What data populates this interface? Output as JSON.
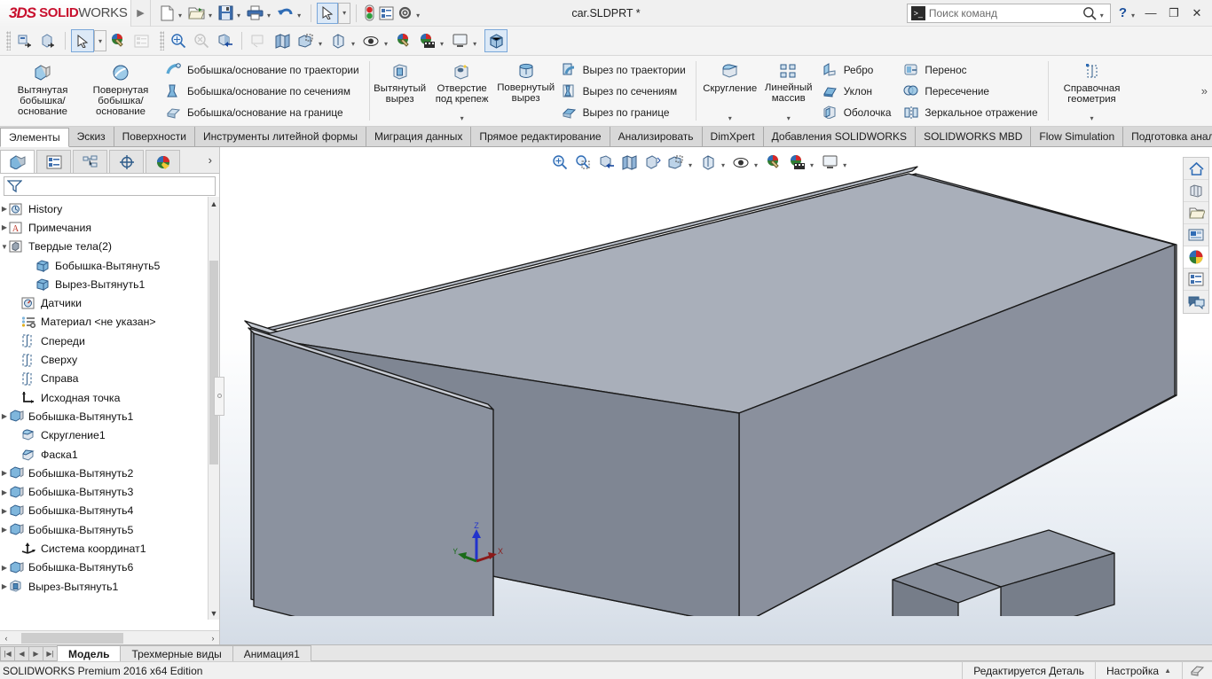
{
  "titlebar": {
    "brand_3ds": "3DS",
    "brand_solid": "SOLID",
    "brand_works": "WORKS",
    "document_title": "car.SLDPRT *",
    "search_placeholder": "Поиск команд",
    "icons": [
      "new-document-icon",
      "open-document-icon",
      "save-icon",
      "print-icon",
      "undo-icon",
      "select-icon",
      "rebuild-icon",
      "options-list-icon",
      "gear-icon"
    ],
    "help_label": "?",
    "minimize_label": "—",
    "restore_label": "❐",
    "close_label": "✕"
  },
  "command_strip": {
    "icons": [
      "import-icon",
      "export-icon",
      "select-arrow-icon",
      "appearance-icon",
      "display-pane-icon",
      "zoom-in-icon",
      "zoom-to-fit-icon",
      "section-view-icon",
      "draft-analysis-icon",
      "view-orientation-icon",
      "display-style-icon",
      "hide-show-icon",
      "appearances-icon",
      "scene-icon",
      "viewport-icon",
      "apply-scene-icon"
    ]
  },
  "ribbon": {
    "groups": [
      {
        "name": "boss-group",
        "big": [
          {
            "label": "Вытянутая\nбобышка/основание",
            "icon": "extruded-boss-icon",
            "dropdown": false
          },
          {
            "label": "Повернутая\nбобышка/основание",
            "icon": "revolved-boss-icon",
            "dropdown": false
          }
        ],
        "small": [
          {
            "label": "Бобышка/основание по траектории",
            "icon": "swept-boss-icon"
          },
          {
            "label": "Бобышка/основание по сечениям",
            "icon": "lofted-boss-icon"
          },
          {
            "label": "Бобышка/основание на границе",
            "icon": "boundary-boss-icon"
          }
        ]
      },
      {
        "name": "cut-group",
        "big": [
          {
            "label": "Вытянутый\nвырез",
            "icon": "extruded-cut-icon",
            "dropdown": false
          },
          {
            "label": "Отверстие\nпод крепеж",
            "icon": "hole-wizard-icon",
            "dropdown": true
          },
          {
            "label": "Повернутый\nвырез",
            "icon": "revolved-cut-icon",
            "dropdown": false
          }
        ],
        "small": [
          {
            "label": "Вырез по траектории",
            "icon": "swept-cut-icon"
          },
          {
            "label": "Вырез по сечениям",
            "icon": "lofted-cut-icon"
          },
          {
            "label": "Вырез по границе",
            "icon": "boundary-cut-icon"
          }
        ]
      },
      {
        "name": "feature-group",
        "big": [
          {
            "label": "Скругление",
            "icon": "fillet-icon",
            "dropdown": true
          },
          {
            "label": "Линейный\nмассив",
            "icon": "linear-pattern-icon",
            "dropdown": true
          }
        ],
        "small": [
          {
            "label": "Ребро",
            "icon": "rib-icon"
          },
          {
            "label": "Уклон",
            "icon": "draft-icon"
          },
          {
            "label": "Оболочка",
            "icon": "shell-icon"
          }
        ],
        "small2": [
          {
            "label": "Перенос",
            "icon": "move-icon"
          },
          {
            "label": "Пересечение",
            "icon": "intersect-icon"
          },
          {
            "label": "Зеркальное отражение",
            "icon": "mirror-icon"
          }
        ]
      },
      {
        "name": "reference-group",
        "big": [
          {
            "label": "Справочная\nгеометрия",
            "icon": "reference-geometry-icon",
            "dropdown": true
          }
        ]
      }
    ],
    "overflow_label": "»"
  },
  "tabs": [
    {
      "label": "Элементы",
      "active": true
    },
    {
      "label": "Эскиз",
      "active": false
    },
    {
      "label": "Поверхности",
      "active": false
    },
    {
      "label": "Инструменты литейной формы",
      "active": false
    },
    {
      "label": "Миграция данных",
      "active": false
    },
    {
      "label": "Прямое редактирование",
      "active": false
    },
    {
      "label": "Анализировать",
      "active": false
    },
    {
      "label": "DimXpert",
      "active": false
    },
    {
      "label": "Добавления SOLIDWORKS",
      "active": false
    },
    {
      "label": "SOLIDWORKS MBD",
      "active": false
    },
    {
      "label": "Flow Simulation",
      "active": false
    },
    {
      "label": "Подготовка анализа",
      "active": false
    }
  ],
  "feature_manager": {
    "tabs": [
      {
        "name": "feature-tree-tab",
        "icon": "feature-tree-icon",
        "active": true
      },
      {
        "name": "property-manager-tab",
        "icon": "property-manager-icon",
        "active": false
      },
      {
        "name": "configuration-manager-tab",
        "icon": "configuration-icon",
        "active": false
      },
      {
        "name": "dimxpert-manager-tab",
        "icon": "dimxpert-icon",
        "active": false
      },
      {
        "name": "display-manager-tab",
        "icon": "display-manager-icon",
        "active": false
      }
    ],
    "more_label": "›",
    "filter_placeholder": "",
    "tree": [
      {
        "label": "History",
        "icon": "history-icon",
        "indent": 0,
        "twisty": "collapsed"
      },
      {
        "label": "Примечания",
        "icon": "annotations-icon",
        "indent": 0,
        "twisty": "collapsed"
      },
      {
        "label": "Твердые тела(2)",
        "icon": "solid-bodies-icon",
        "indent": 0,
        "twisty": "expanded"
      },
      {
        "label": "Бобышка-Вытянуть5",
        "icon": "body-icon",
        "indent": 2,
        "twisty": "none"
      },
      {
        "label": "Вырез-Вытянуть1",
        "icon": "body-icon",
        "indent": 2,
        "twisty": "none"
      },
      {
        "label": "Датчики",
        "icon": "sensors-icon",
        "indent": 1,
        "twisty": "none"
      },
      {
        "label": "Материал <не указан>",
        "icon": "material-icon",
        "indent": 1,
        "twisty": "none"
      },
      {
        "label": "Спереди",
        "icon": "plane-icon",
        "indent": 1,
        "twisty": "none"
      },
      {
        "label": "Сверху",
        "icon": "plane-icon",
        "indent": 1,
        "twisty": "none"
      },
      {
        "label": "Справа",
        "icon": "plane-icon",
        "indent": 1,
        "twisty": "none"
      },
      {
        "label": "Исходная точка",
        "icon": "origin-icon",
        "indent": 1,
        "twisty": "none"
      },
      {
        "label": "Бобышка-Вытянуть1",
        "icon": "extrude-feature-icon",
        "indent": 0,
        "twisty": "collapsed"
      },
      {
        "label": "Скругление1",
        "icon": "fillet-feature-icon",
        "indent": 1,
        "twisty": "none"
      },
      {
        "label": "Фаска1",
        "icon": "chamfer-feature-icon",
        "indent": 1,
        "twisty": "none"
      },
      {
        "label": "Бобышка-Вытянуть2",
        "icon": "extrude-feature-icon",
        "indent": 0,
        "twisty": "collapsed"
      },
      {
        "label": "Бобышка-Вытянуть3",
        "icon": "extrude-feature-icon",
        "indent": 0,
        "twisty": "collapsed"
      },
      {
        "label": "Бобышка-Вытянуть4",
        "icon": "extrude-feature-icon",
        "indent": 0,
        "twisty": "collapsed"
      },
      {
        "label": "Бобышка-Вытянуть5",
        "icon": "extrude-feature-icon",
        "indent": 0,
        "twisty": "collapsed"
      },
      {
        "label": "Система координат1",
        "icon": "coordinate-system-icon",
        "indent": 1,
        "twisty": "none"
      },
      {
        "label": "Бобышка-Вытянуть6",
        "icon": "extrude-feature-icon",
        "indent": 0,
        "twisty": "collapsed"
      },
      {
        "label": "Вырез-Вытянуть1",
        "icon": "cut-feature-icon",
        "indent": 0,
        "twisty": "collapsed"
      }
    ],
    "hscroll_left": "‹",
    "hscroll_right": "›"
  },
  "viewport": {
    "toolbar_icons": [
      "zoom-to-fit-icon",
      "zoom-to-area-icon",
      "section-view-icon",
      "view-orientation-icon",
      "draft-analysis-icon",
      "display-style-icon",
      "hide-show-icon",
      "edit-appearance-icon",
      "apply-scene-icon",
      "viewport-icon"
    ],
    "right_icons": [
      "home-view-icon",
      "appearances-icon",
      "scenes-folder-icon",
      "decals-icon",
      "colors-icon",
      "custom-properties-icon",
      "comments-icon"
    ],
    "triad": {
      "x_label": "X",
      "y_label": "Y",
      "z_label": "Z",
      "x_color": "#8b1a1a",
      "y_color": "#1a6b1a",
      "z_color": "#2233cc"
    },
    "model_colors": {
      "face_light": "#9ca3af",
      "face_mid": "#878e9b",
      "face_dark": "#767c88",
      "face_darker": "#6c727e",
      "edge": "#1c1c1c"
    },
    "origin_marker_color": "#1515dd"
  },
  "bottom": {
    "nav_buttons": [
      "first-icon",
      "prev-icon",
      "next-icon",
      "last-icon"
    ],
    "tabs": [
      {
        "label": "Модель",
        "active": true
      },
      {
        "label": "Трехмерные виды",
        "active": false
      },
      {
        "label": "Анимация1",
        "active": false
      }
    ]
  },
  "statusbar": {
    "edition": "SOLIDWORKS Premium 2016 x64 Edition",
    "edit_state": "Редактируется Деталь",
    "config_label": "Настройка",
    "config_caret": "▲",
    "tail_icon": "overlay-icon"
  }
}
